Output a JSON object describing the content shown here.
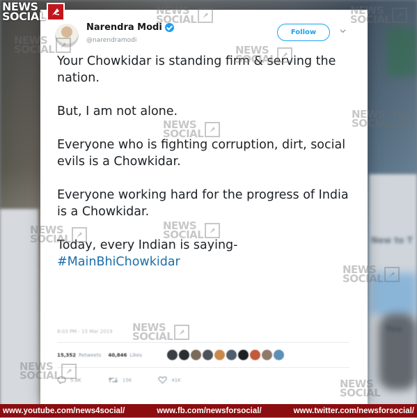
{
  "brand": {
    "logo_text": [
      "NEWS",
      "SOCIAL"
    ],
    "accent": "#c0161c",
    "footer_color": "#8b0d0f"
  },
  "tweet": {
    "author_name": "Narendra Modi",
    "handle": "@narendramodi",
    "follow_label": "Follow",
    "paragraphs": [
      "Your Chowkidar is standing firm & serving the nation.",
      "But, I am not alone.",
      "Everyone who is fighting corruption, dirt, social evils is a Chowkidar.",
      "Everyone working hard for the progress of India is a Chowkidar.",
      "Today, every Indian is saying-"
    ],
    "hashtag": "#MainBhiChowkidar",
    "timestamp": "8:03 PM - 15 Mar 2019",
    "retweets_count": "15,352",
    "retweets_label": "Retweets",
    "likes_count": "40,846",
    "likes_label": "Likes",
    "reply_count": "5.8K",
    "retweet_action_count": "15K",
    "like_action_count": "41K",
    "link_color": "#1b6fa8",
    "verified_color": "#1da1f2"
  },
  "background": {
    "side_text_1": "New to T",
    "side_text_2": "You"
  },
  "footer": {
    "links": [
      "www.youtube.com/news4social/",
      "www.fb.com/newsforsocial/",
      "www.twitter.com/newsforsocial/"
    ]
  }
}
